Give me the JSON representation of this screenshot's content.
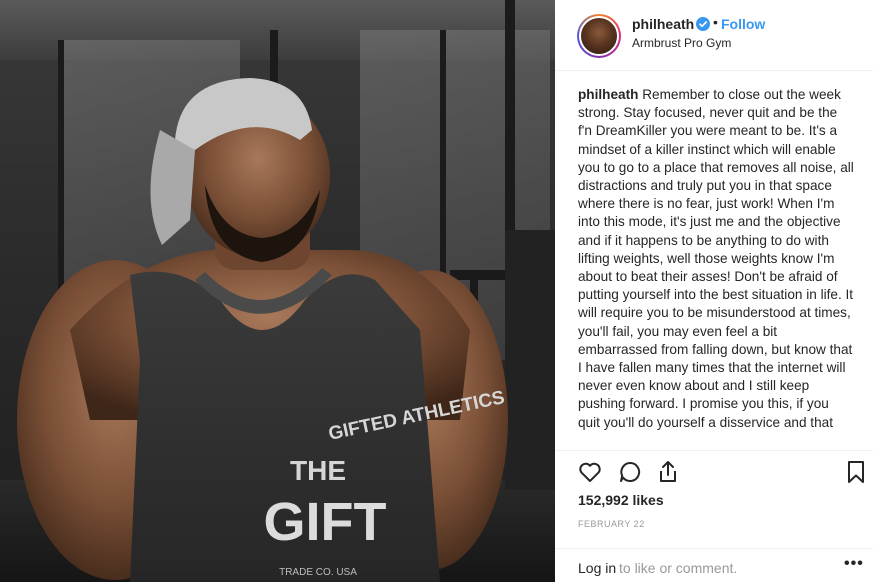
{
  "post": {
    "username": "philheath",
    "follow_label": "Follow",
    "location": "Armbrust Pro Gym",
    "caption_author": "philheath",
    "caption_text": " Remember to close out the week strong. Stay focused, never quit and be the f'n DreamKiller you were meant to be. It's a mindset of a killer instinct which will enable you to go to a place that removes all noise, all distractions and truly put you in that space where there is no fear, just work! When I'm into this mode, it's just me and the objective and if it happens to be anything to do with lifting weights, well those weights know I'm about to beat their asses! Don't be afraid of putting yourself into the best situation in life. It will require you to be misunderstood at times, you'll fail, you may even feel a bit embarrassed from falling down, but know that I have fallen many times that the internet will never even know about and I still keep pushing forward. I promise you this, if you quit you'll do yourself a disservice and that",
    "likes": "152,992 likes",
    "date": "FEBRUARY 22"
  },
  "photo": {
    "shirt_text_top": "GIFTED ATHLETICS",
    "shirt_text_the": "THE",
    "shirt_text_gift": "GIFT",
    "shirt_text_bottom": "TRADE CO. USA"
  },
  "comment_bar": {
    "login_label": "Log in",
    "login_rest": "to like or comment.",
    "more_label": "•••"
  },
  "colors": {
    "accent": "#3897f0",
    "text": "#262626",
    "muted": "#999999",
    "border": "#efefef"
  },
  "icons": [
    "verified-badge-icon",
    "heart-icon",
    "comment-icon",
    "share-icon",
    "bookmark-icon",
    "more-options-icon"
  ]
}
